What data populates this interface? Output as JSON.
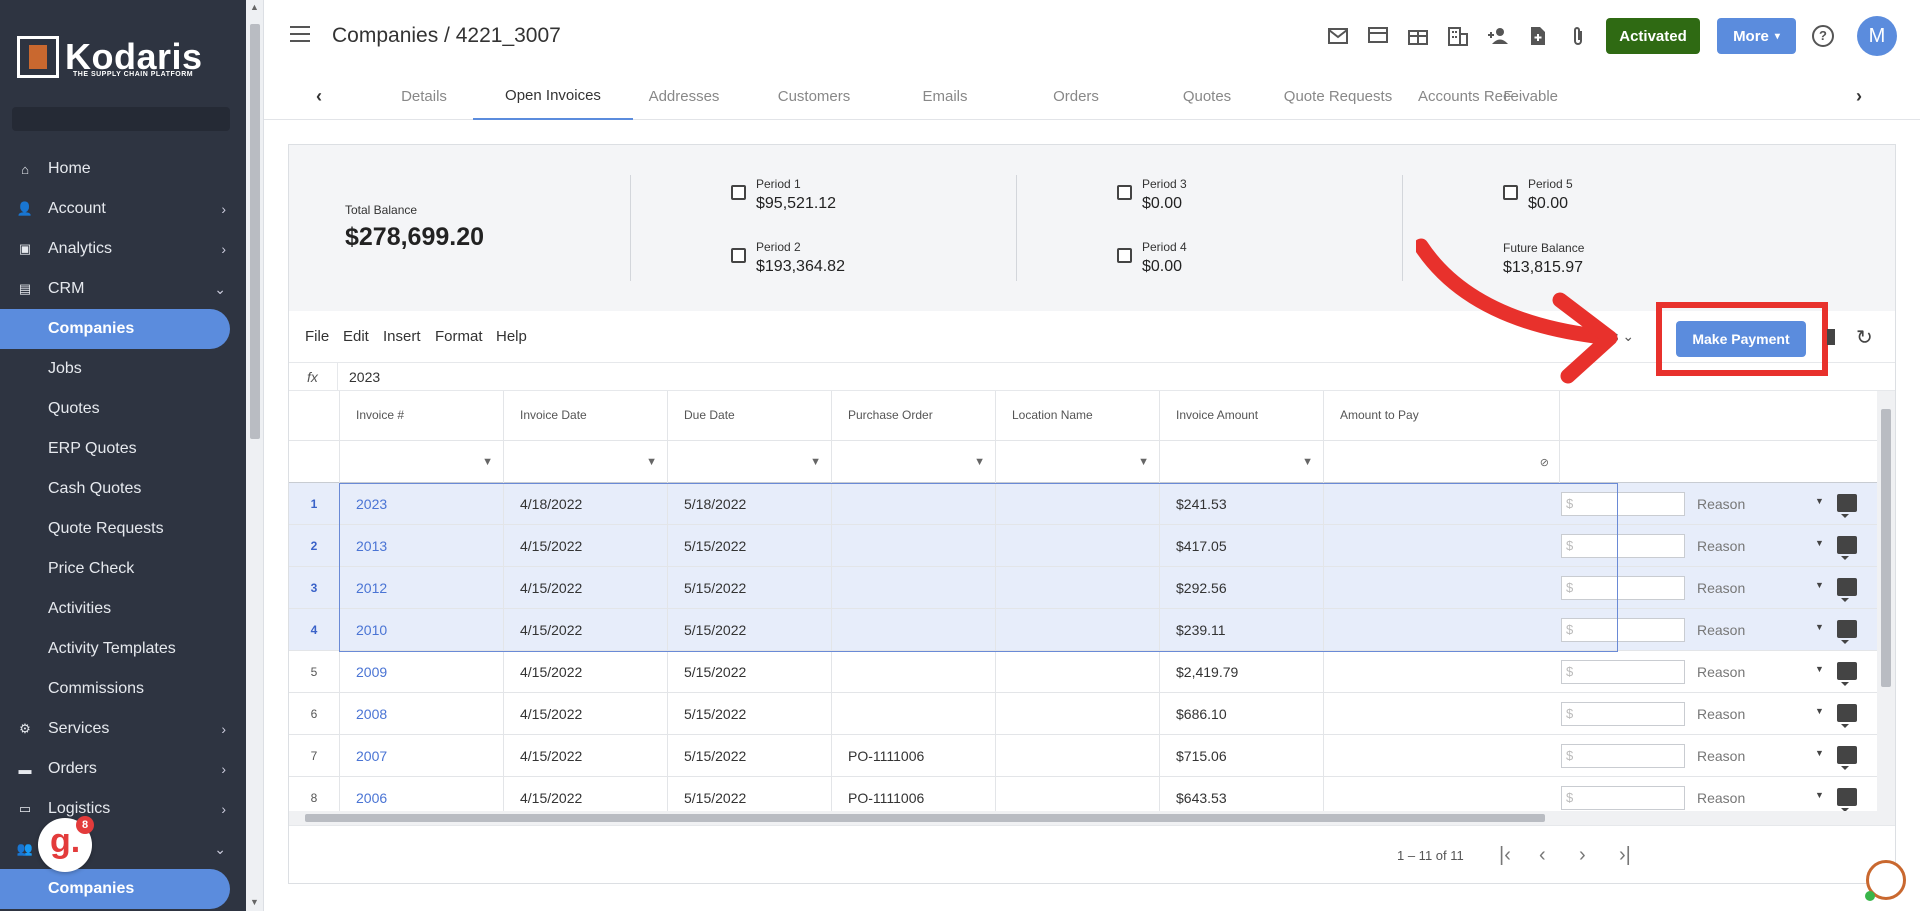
{
  "brand": {
    "name": "Kodaris",
    "tagline": "THE SUPPLY CHAIN PLATFORM"
  },
  "sidebar": {
    "items": [
      {
        "label": "Home",
        "icon": "home-icon"
      },
      {
        "label": "Account",
        "icon": "person-icon"
      },
      {
        "label": "Analytics",
        "icon": "analytics-icon"
      },
      {
        "label": "CRM",
        "icon": "crm-icon"
      },
      {
        "label": "Companies",
        "icon": ""
      },
      {
        "label": "Jobs",
        "icon": ""
      },
      {
        "label": "Quotes",
        "icon": ""
      },
      {
        "label": "ERP Quotes",
        "icon": ""
      },
      {
        "label": "Cash Quotes",
        "icon": ""
      },
      {
        "label": "Quote Requests",
        "icon": ""
      },
      {
        "label": "Price Check",
        "icon": ""
      },
      {
        "label": "Activities",
        "icon": ""
      },
      {
        "label": "Activity Templates",
        "icon": ""
      },
      {
        "label": "Commissions",
        "icon": ""
      },
      {
        "label": "Services",
        "icon": "gears-icon"
      },
      {
        "label": "Orders",
        "icon": "truck-icon"
      },
      {
        "label": "Logistics",
        "icon": "shipping-icon"
      },
      {
        "label": "Users",
        "icon": "group-icon"
      },
      {
        "label": "Companies",
        "icon": ""
      }
    ]
  },
  "header": {
    "breadcrumb": "Companies / 4221_3007",
    "status_button": "Activated",
    "more_button": "More",
    "avatar_initial": "M",
    "status_color": "#2f6a13",
    "accent_color": "#5b8cdd"
  },
  "tabs": [
    "Details",
    "Open Invoices",
    "Addresses",
    "Customers",
    "Emails",
    "Orders",
    "Quotes",
    "Quote Requests",
    "Accounts Receivable",
    "F"
  ],
  "summary": {
    "total_label": "Total Balance",
    "total_value": "$278,699.20",
    "periods": [
      {
        "label": "Period 1",
        "value": "$95,521.12"
      },
      {
        "label": "Period 2",
        "value": "$193,364.82"
      },
      {
        "label": "Period 3",
        "value": "$0.00"
      },
      {
        "label": "Period 4",
        "value": "$0.00"
      },
      {
        "label": "Period 5",
        "value": "$0.00"
      }
    ],
    "future_label": "Future Balance",
    "future_value": "$13,815.97"
  },
  "menubar": {
    "items": [
      "File",
      "Edit",
      "Insert",
      "Format",
      "Help"
    ],
    "filters_partial": "ers",
    "make_payment": "Make Payment"
  },
  "formula": {
    "fx": "fx",
    "value": "2023"
  },
  "grid": {
    "columns": [
      "Invoice #",
      "Invoice Date",
      "Due Date",
      "Purchase Order",
      "Location Name",
      "Invoice Amount",
      "Amount to Pay"
    ],
    "amount_placeholder": "$",
    "reason_label": "Reason",
    "rows": [
      {
        "n": "1",
        "invoice": "2023",
        "invoice_date": "4/18/2022",
        "due_date": "5/18/2022",
        "po": "",
        "location": "",
        "amount": "$241.53",
        "selected": true
      },
      {
        "n": "2",
        "invoice": "2013",
        "invoice_date": "4/15/2022",
        "due_date": "5/15/2022",
        "po": "",
        "location": "",
        "amount": "$417.05",
        "selected": true
      },
      {
        "n": "3",
        "invoice": "2012",
        "invoice_date": "4/15/2022",
        "due_date": "5/15/2022",
        "po": "",
        "location": "",
        "amount": "$292.56",
        "selected": true
      },
      {
        "n": "4",
        "invoice": "2010",
        "invoice_date": "4/15/2022",
        "due_date": "5/15/2022",
        "po": "",
        "location": "",
        "amount": "$239.11",
        "selected": true
      },
      {
        "n": "5",
        "invoice": "2009",
        "invoice_date": "4/15/2022",
        "due_date": "5/15/2022",
        "po": "",
        "location": "",
        "amount": "$2,419.79",
        "selected": false
      },
      {
        "n": "6",
        "invoice": "2008",
        "invoice_date": "4/15/2022",
        "due_date": "5/15/2022",
        "po": "",
        "location": "",
        "amount": "$686.10",
        "selected": false
      },
      {
        "n": "7",
        "invoice": "2007",
        "invoice_date": "4/15/2022",
        "due_date": "5/15/2022",
        "po": "PO-1111006",
        "location": "",
        "amount": "$715.06",
        "selected": false
      },
      {
        "n": "8",
        "invoice": "2006",
        "invoice_date": "4/15/2022",
        "due_date": "5/15/2022",
        "po": "PO-1111006",
        "location": "",
        "amount": "$643.53",
        "selected": false
      }
    ]
  },
  "pager": {
    "text": "1 – 11 of 11"
  },
  "notification_count": "8",
  "annotation_color": "#e8312c"
}
